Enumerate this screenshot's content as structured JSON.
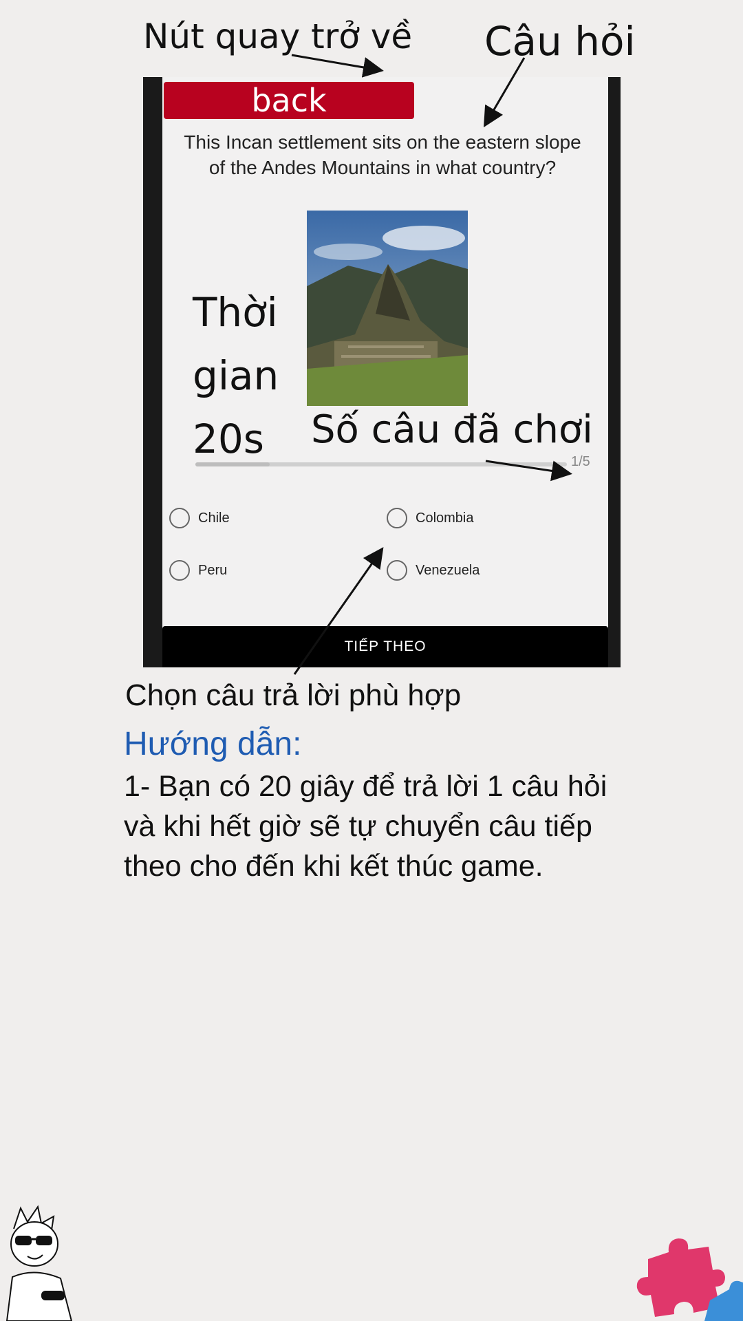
{
  "annotations": {
    "back_label": "Nút quay trở về",
    "question_label": "Câu hỏi",
    "timer_label": "Thời\ngian\n20s",
    "count_label": "Số câu đã chơi",
    "answer_label": "Chọn câu trả lời phù hợp"
  },
  "app": {
    "back_button": "back",
    "question": "This Incan settlement sits on the eastern slope of the Andes Mountains in what country?",
    "progress": {
      "current_text": "1/5",
      "fraction": 0.2
    },
    "options": [
      "Chile",
      "Colombia",
      "Peru",
      "Venezuela"
    ],
    "next_button": "TIẾP THEO"
  },
  "guide": {
    "title": "Hướng dẫn:",
    "body": "1- Bạn có 20 giây để trả lời 1 câu hỏi và khi hết giờ sẽ tự chuyển câu tiếp theo cho đến khi kết thúc game."
  },
  "colors": {
    "back_button": "#b8021f",
    "guide_title": "#1f5cb2",
    "background": "#f0eeed"
  }
}
